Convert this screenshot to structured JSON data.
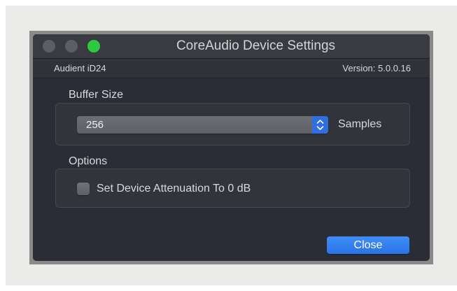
{
  "window": {
    "title": "CoreAudio Device Settings"
  },
  "device": {
    "name": "Audient iD24",
    "version": "Version: 5.0.0.16"
  },
  "buffer_size": {
    "label": "Buffer Size",
    "selected_value": "256",
    "unit_label": "Samples"
  },
  "options": {
    "label": "Options",
    "attenuation_label": "Set Device Attenuation To 0 dB",
    "attenuation_checked": false
  },
  "footer": {
    "close_label": "Close"
  },
  "colors": {
    "accent": "#2f6fe0",
    "window_bg": "#2b2d36",
    "zoom_button": "#2dc93f"
  }
}
